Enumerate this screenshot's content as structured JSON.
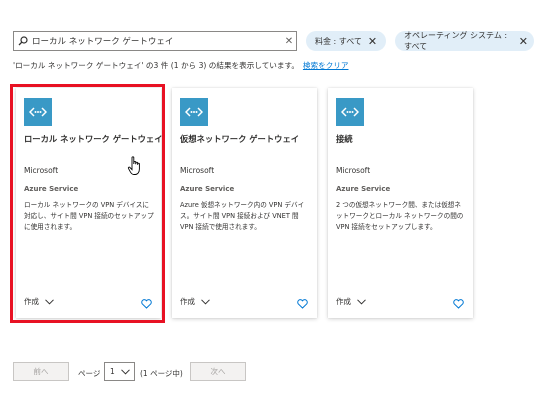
{
  "search": {
    "value": "ローカル ネットワーク ゲートウェイ",
    "clear_label": "✕"
  },
  "filters": [
    {
      "label": "料金 : すべて"
    },
    {
      "label": "オペレーティング システム : すべて"
    }
  ],
  "results": {
    "text": "'ローカル ネットワーク ゲートウェイ' の3 件 (1 から 3) の結果を表示しています。",
    "clear_link": "検索をクリア"
  },
  "cards": [
    {
      "title": "ローカル ネットワーク ゲートウェイ",
      "publisher": "Microsoft",
      "type": "Azure Service",
      "description": "ローカル ネットワークの VPN デバイスに対応し、サイト間 VPN 接続のセットアップに使用されます。",
      "create_label": "作成"
    },
    {
      "title": "仮想ネットワーク ゲートウェイ",
      "publisher": "Microsoft",
      "type": "Azure Service",
      "description": "Azure 仮想ネットワーク内の VPN デバイス。サイト間 VPN 接続および VNET 間 VPN 接続で使用されます。",
      "create_label": "作成"
    },
    {
      "title": "接続",
      "publisher": "Microsoft",
      "type": "Azure Service",
      "description": "2 つの仮想ネットワーク間、または仮想ネットワークとローカル ネットワークの間の VPN 接続をセットアップします。",
      "create_label": "作成"
    }
  ],
  "pagination": {
    "prev_label": "前へ",
    "page_label": "ページ",
    "current_page": "1",
    "of_label": "(1 ページ中)",
    "next_label": "次へ"
  },
  "colors": {
    "accent": "#0078d4",
    "highlight": "#e81123",
    "icon_tile": "#3999c6",
    "pill": "#e1eef8"
  },
  "icons": [
    "search-icon",
    "close-icon",
    "gateway-icon",
    "chevron-down-icon",
    "heart-icon",
    "hand-cursor-icon"
  ]
}
